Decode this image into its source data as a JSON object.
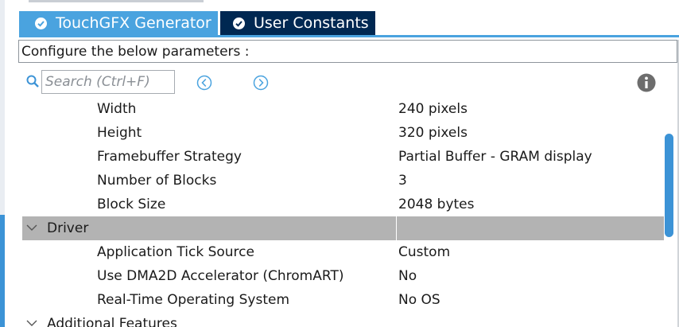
{
  "tabs": [
    {
      "label": "TouchGFX Generator",
      "active": false
    },
    {
      "label": "User Constants",
      "active": true
    }
  ],
  "config_text": "Configure the below parameters :",
  "search": {
    "placeholder": "Search (Ctrl+F)",
    "value": ""
  },
  "parameters": {
    "display": [
      {
        "name": "Width",
        "value": "240 pixels"
      },
      {
        "name": "Height",
        "value": "320 pixels"
      },
      {
        "name": "Framebuffer Strategy",
        "value": "Partial Buffer - GRAM display"
      },
      {
        "name": "Number of Blocks",
        "value": "3"
      },
      {
        "name": "Block Size",
        "value": "2048 bytes"
      }
    ],
    "driver_group": {
      "label": "Driver"
    },
    "driver": [
      {
        "name": "Application Tick Source",
        "value": "Custom"
      },
      {
        "name": "Use DMA2D Accelerator (ChromART)",
        "value": "No"
      },
      {
        "name": "Real-Time Operating System",
        "value": "No OS"
      }
    ],
    "additional_group": {
      "label": "Additional Features"
    }
  },
  "colors": {
    "tab_inactive": "#4aa3df",
    "tab_active": "#002852",
    "group_header": "#b3b3b3",
    "accent": "#3c93d6"
  },
  "icons": {
    "tab_check": "check-circle-icon",
    "search": "search-icon",
    "previous": "chevron-left-circle-icon",
    "next": "chevron-right-circle-icon",
    "info": "info-icon",
    "group_toggle": "chevron-down-icon"
  }
}
